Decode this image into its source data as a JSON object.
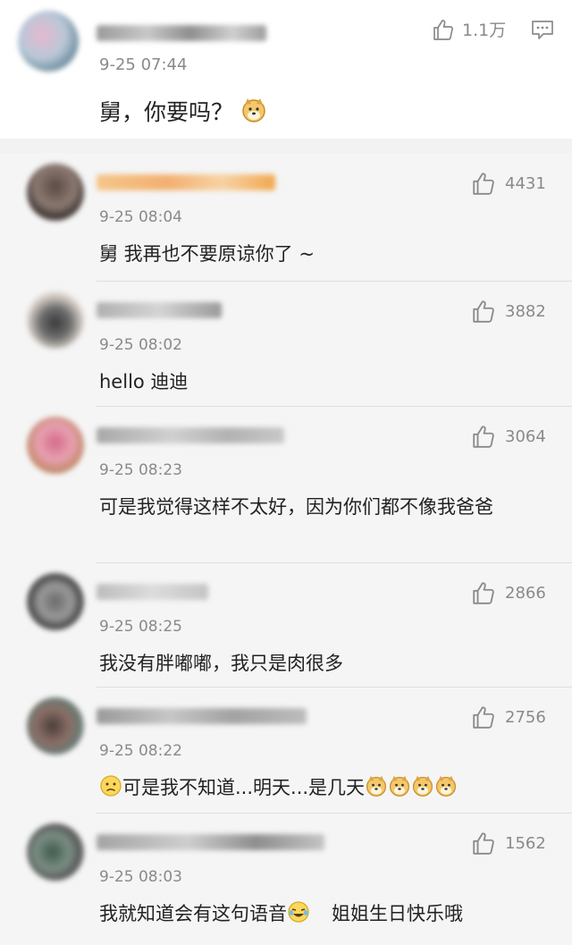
{
  "post": {
    "time": "9-25 07:44",
    "text": "舅，你要吗？",
    "likes": "1.1万",
    "emoji": "doge"
  },
  "comments": [
    {
      "time": "9-25 08:04",
      "likes": "4431",
      "text": "舅 我再也不要原谅你了 ~"
    },
    {
      "time": "9-25 08:02",
      "likes": "3882",
      "text": "hello 迪迪"
    },
    {
      "time": "9-25 08:23",
      "likes": "3064",
      "text": "可是我觉得这样不太好，因为你们都不像我爸爸"
    },
    {
      "time": "9-25 08:25",
      "likes": "2866",
      "text": "我没有胖嘟嘟，我只是肉很多"
    },
    {
      "time": "9-25 08:22",
      "likes": "2756",
      "text_a": "可是我不知道...明天...是几天",
      "emojis": [
        "sad",
        "doge",
        "doge",
        "doge",
        "doge"
      ]
    },
    {
      "time": "9-25 08:03",
      "likes": "1562",
      "text_a": "我就知道会有这句语音",
      "text_b": "姐姐生日快乐哦",
      "emoji": "laugh-cry"
    }
  ],
  "colors": {
    "meta_gray": "#8a8a8a",
    "text": "#222222",
    "background": "#f5f5f5"
  }
}
